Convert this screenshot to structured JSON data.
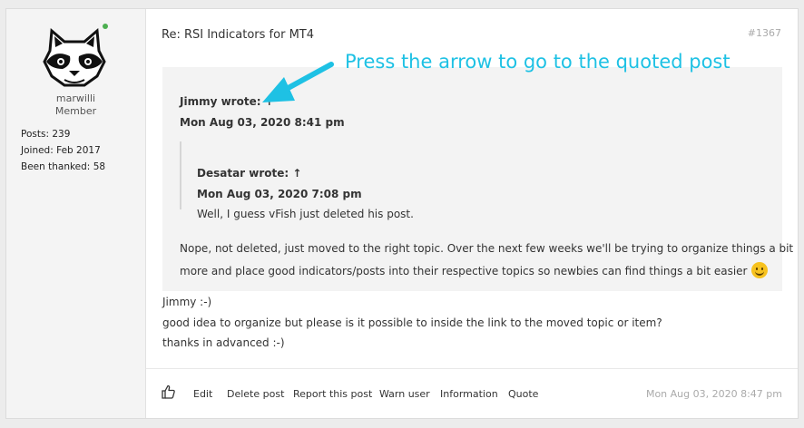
{
  "post": {
    "title": "Re: RSI Indicators for MT4",
    "number": "#1367",
    "annotation": "Press the arrow to go to the quoted post",
    "author": {
      "username": "marwilli",
      "rank": "Member",
      "posts_label": "Posts:",
      "posts_value": "239",
      "joined_label": "Joined:",
      "joined_value": "Feb 2017",
      "thanked_label": "Been thanked:",
      "thanked_value": "58"
    },
    "quote": {
      "author": "Jimmy wrote: ↑",
      "date": "Mon Aug 03, 2020 8:41 pm",
      "inner": {
        "author": "Desatar wrote: ↑",
        "date": "Mon Aug 03, 2020 7:08 pm",
        "text": "Well, I guess vFish just deleted his post."
      },
      "text_line1": "Nope, not deleted, just moved to the right topic. Over the next few weeks we'll be trying to organize things a bit",
      "text_line2": "more and place good indicators/posts into their respective topics so newbies can find things a bit easier"
    },
    "body": [
      "Jimmy :-)",
      "good idea to organize but please is it possible to inside the link to the moved topic or item?",
      "thanks in advanced :-)"
    ],
    "actions": {
      "edit": "Edit",
      "delete": "Delete post",
      "report": "Report this post",
      "warn": "Warn user",
      "information": "Information",
      "quote": "Quote"
    },
    "footer_date": "Mon Aug 03, 2020 8:47 pm"
  },
  "colors": {
    "annotation": "#1ec1e4",
    "online": "#4caf50",
    "sidebar_bg": "#f4f4f4",
    "quote_bg": "#f3f3f3"
  },
  "icons": {
    "avatar": "raccoon-avatar",
    "like": "thumbs-up-icon",
    "smiley": "smiley-icon",
    "arrow": "annotation-arrow"
  }
}
